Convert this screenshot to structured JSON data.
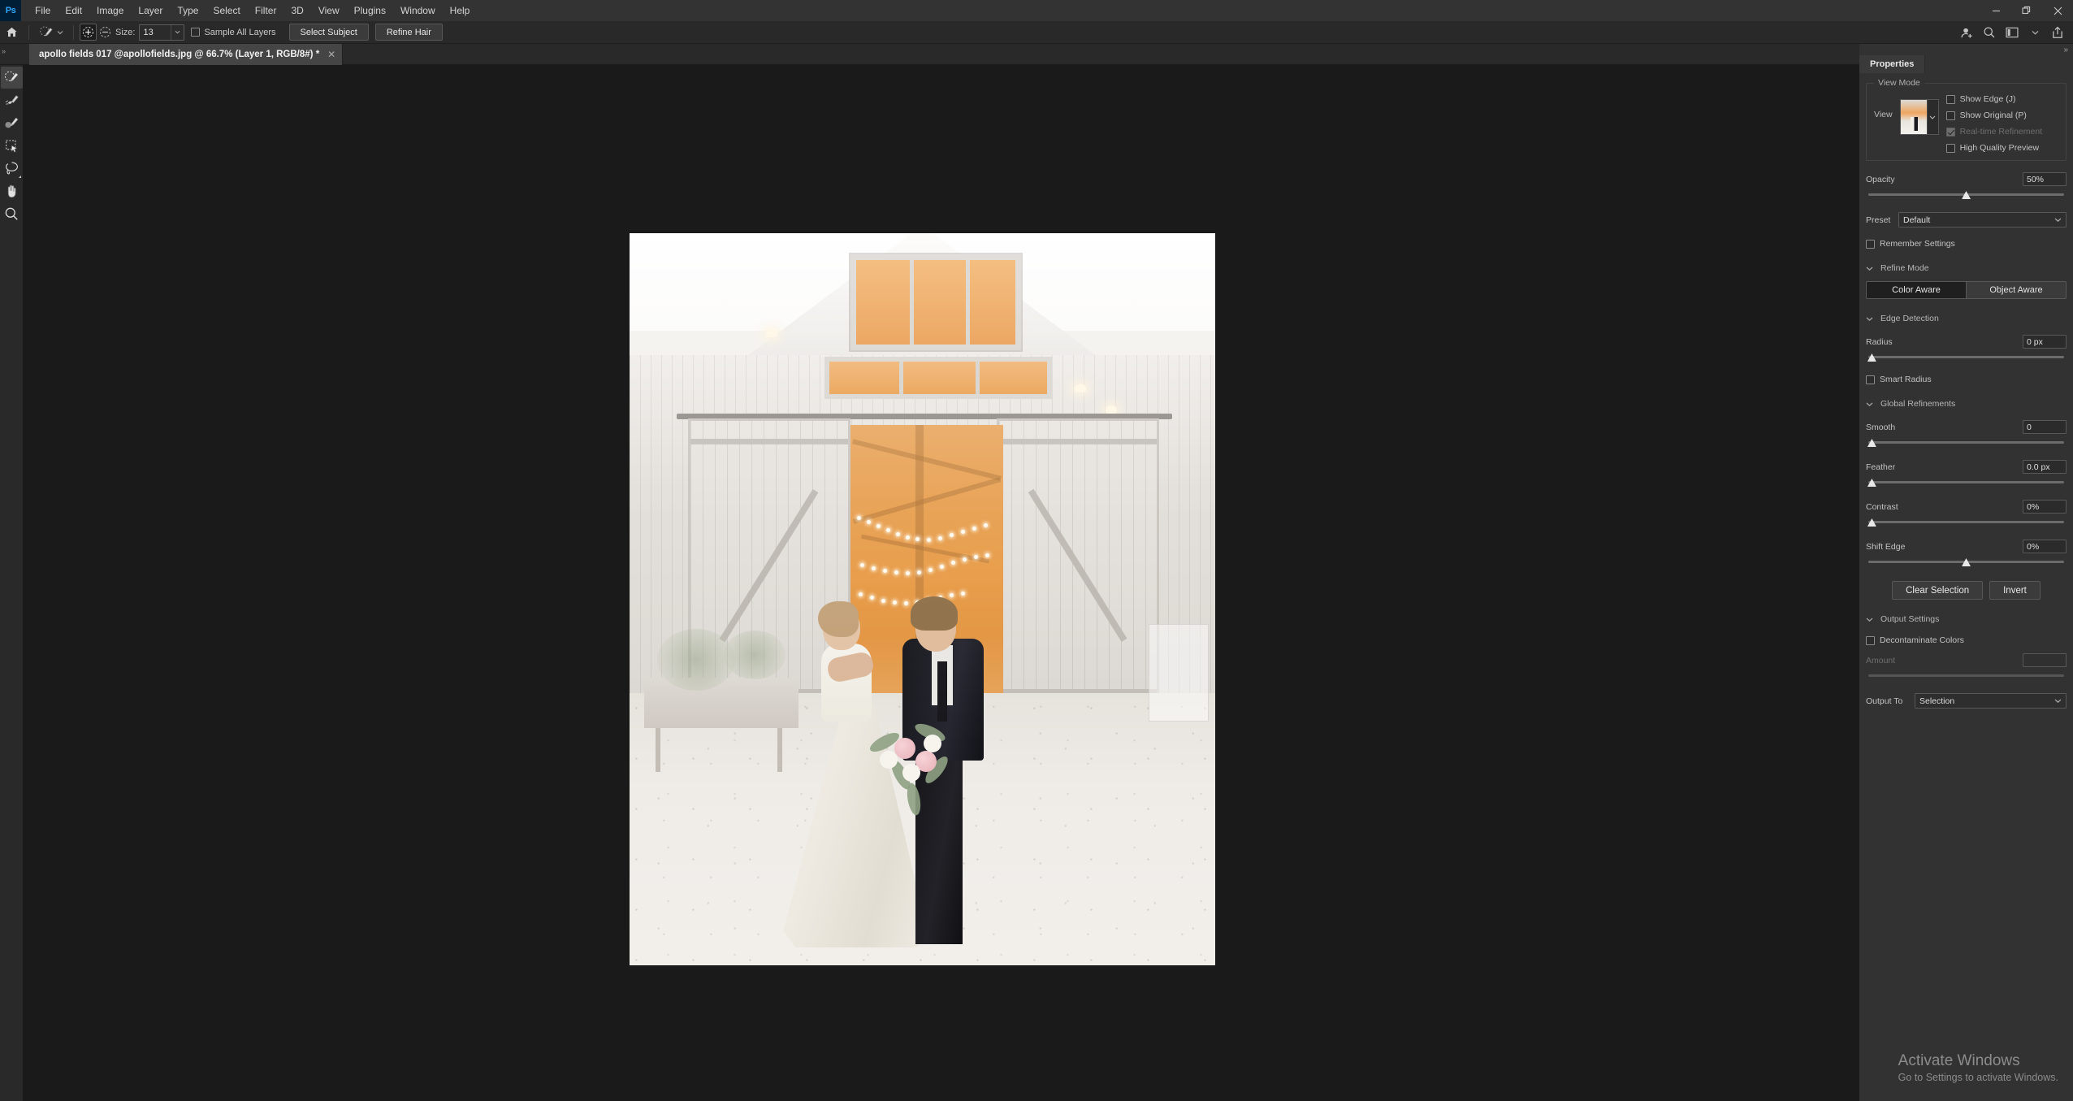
{
  "app": {
    "logo_text": "Ps",
    "menus": [
      "File",
      "Edit",
      "Image",
      "Layer",
      "Type",
      "Select",
      "Filter",
      "3D",
      "View",
      "Plugins",
      "Window",
      "Help"
    ],
    "window_controls": {
      "minimize": "minimize-icon",
      "restore": "restore-icon",
      "close": "close-icon"
    }
  },
  "options_bar": {
    "home_icon": "home-icon",
    "brush_preview_icon": "quick-selection-brush-icon",
    "brush_preview_caret": "chevron-down-icon",
    "add_mode_icon": "add-to-selection-icon",
    "subtract_mode_icon": "subtract-from-selection-icon",
    "size_label": "Size:",
    "size_value": "13",
    "size_stepper_icon": "chevron-down-icon",
    "sample_all_layers_label": "Sample All Layers",
    "sample_all_layers_checked": false,
    "select_subject_label": "Select Subject",
    "refine_hair_label": "Refine Hair",
    "right_icons": [
      "add-user-icon",
      "search-icon",
      "workspace-icon",
      "chevron-down-icon",
      "share-icon"
    ]
  },
  "document": {
    "tab_title": "apollo fields 017 @apollofields.jpg @ 66.7% (Layer 1, RGB/8#) *",
    "tab_close_icon": "close-icon",
    "zoom_level": "66.7%",
    "layer_name": "Layer 1",
    "color_mode": "RGB/8#"
  },
  "toolbar": {
    "tools": [
      {
        "name": "quick-selection-tool",
        "label": "Quick Selection Tool",
        "active": true,
        "has_flyout": false
      },
      {
        "name": "refine-edge-brush-tool",
        "label": "Refine Edge Brush Tool",
        "active": false,
        "has_flyout": false
      },
      {
        "name": "brush-tool",
        "label": "Brush Tool",
        "active": false,
        "has_flyout": false
      },
      {
        "name": "object-selection-tool",
        "label": "Object Selection Tool",
        "active": false,
        "has_flyout": false
      },
      {
        "name": "lasso-tool",
        "label": "Lasso Tool",
        "active": false,
        "has_flyout": true
      },
      {
        "name": "hand-tool",
        "label": "Hand Tool",
        "active": false,
        "has_flyout": false
      },
      {
        "name": "zoom-tool",
        "label": "Zoom Tool",
        "active": false,
        "has_flyout": false
      }
    ]
  },
  "properties_panel": {
    "collapse_icon": "chevrons-right-icon",
    "tab_label": "Properties",
    "view_mode": {
      "group_title": "View Mode",
      "view_label": "View",
      "view_thumb_caret": "chevron-down-icon",
      "checks": [
        {
          "label": "Show Edge (J)",
          "checked": false,
          "disabled": false
        },
        {
          "label": "Show Original (P)",
          "checked": false,
          "disabled": false
        },
        {
          "label": "Real-time Refinement",
          "checked": true,
          "disabled": true
        },
        {
          "label": "High Quality Preview",
          "checked": false,
          "disabled": false
        }
      ]
    },
    "opacity": {
      "label": "Opacity",
      "value": "50%",
      "percent": 50
    },
    "preset": {
      "label": "Preset",
      "value": "Default",
      "caret": "chevron-down-icon"
    },
    "remember_settings": {
      "label": "Remember Settings",
      "checked": false
    },
    "refine_mode": {
      "title": "Refine Mode",
      "collapse_icon": "chevron-down-icon",
      "options": [
        "Color Aware",
        "Object Aware"
      ],
      "selected": "Color Aware"
    },
    "edge_detection": {
      "title": "Edge Detection",
      "collapse_icon": "chevron-down-icon",
      "radius": {
        "label": "Radius",
        "value": "0 px",
        "percent": 0
      },
      "smart_radius": {
        "label": "Smart Radius",
        "checked": false
      }
    },
    "global_refinements": {
      "title": "Global Refinements",
      "collapse_icon": "chevron-down-icon",
      "sliders": [
        {
          "label": "Smooth",
          "value": "0",
          "percent": 0
        },
        {
          "label": "Feather",
          "value": "0.0 px",
          "percent": 0
        },
        {
          "label": "Contrast",
          "value": "0%",
          "percent": 0
        },
        {
          "label": "Shift Edge",
          "value": "0%",
          "percent": 50
        }
      ],
      "clear_selection_label": "Clear Selection",
      "invert_label": "Invert"
    },
    "output_settings": {
      "title": "Output Settings",
      "collapse_icon": "chevron-down-icon",
      "decontaminate_colors": {
        "label": "Decontaminate Colors",
        "checked": false
      },
      "amount": {
        "label": "Amount",
        "value": "",
        "percent": 100,
        "disabled": true
      },
      "output_to": {
        "label": "Output To",
        "value": "Selection",
        "caret": "chevron-down-icon"
      }
    }
  },
  "watermark": {
    "title": "Activate Windows",
    "subtitle": "Go to Settings to activate Windows."
  },
  "colors": {
    "menubar_bg": "#333333",
    "options_bg": "#292929",
    "panel_bg": "#323232",
    "canvas_bg": "#1a1a1a",
    "accent_blue": "#31a8ff",
    "text_primary": "#e6e6e6",
    "text_secondary": "#b6b6b6"
  }
}
